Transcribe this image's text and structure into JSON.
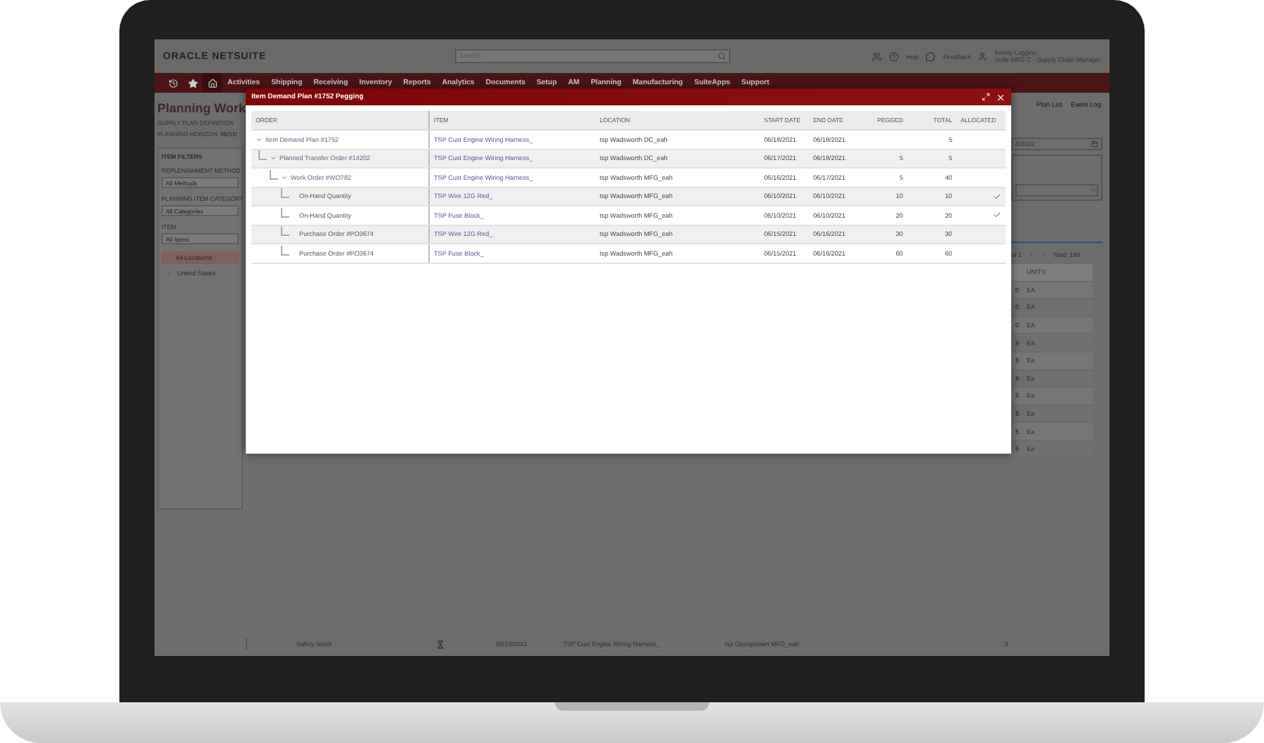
{
  "header": {
    "logo": "ORACLE NETSUITE",
    "search": {
      "placeholder": "Search"
    },
    "help": "Help",
    "feedback": "Feedback",
    "user": {
      "name": "Kenny Loggins",
      "role": "Suite MFG C - Supply Chain Manager"
    }
  },
  "nav": {
    "icons": [
      {
        "kind": "history",
        "selected": false
      },
      {
        "kind": "star",
        "selected": false
      },
      {
        "kind": "home",
        "selected": true
      }
    ],
    "items": [
      "Activities",
      "Shipping",
      "Receiving",
      "Inventory",
      "Reports",
      "Analytics",
      "Documents",
      "Setup",
      "AM",
      "Planning",
      "Manufacturing",
      "SuiteApps",
      "Support"
    ]
  },
  "page": {
    "title": "Planning Work",
    "supply_plan_definition": "SUPPLY PLAN DEFINITION",
    "planning_horizon_label": "PLANNING HORIZON",
    "planning_horizon_value": "06/11/"
  },
  "filters": {
    "title": "ITEM FILTERS",
    "fields": [
      {
        "label": "REPLENISHMENT METHOD",
        "placeholder": "All Methods"
      },
      {
        "label": "PLANNING ITEM CATEGORY",
        "placeholder": "All Categories"
      },
      {
        "label": "ITEM",
        "placeholder": "All Items"
      }
    ],
    "locations": [
      {
        "label": "All Locations",
        "selected": true
      },
      {
        "label": "United States",
        "selected": false,
        "expanded": false
      }
    ]
  },
  "links": [
    "Plan List",
    "Event Log"
  ],
  "date_field": {
    "value": "8/2022"
  },
  "pagination": {
    "page_of": "of 1",
    "total": "Total: 195"
  },
  "units_table": {
    "header": "UNITS",
    "rows": [
      {
        "column_1": "0",
        "units": "EA"
      },
      {
        "column_1": "0",
        "units": "EA"
      },
      {
        "column_1": "0",
        "units": "EA"
      },
      {
        "column_1": "8",
        "units": "EA"
      },
      {
        "column_1": "5",
        "units": "Ea"
      },
      {
        "column_1": "8",
        "units": "Ea"
      },
      {
        "column_1": "5",
        "units": "Ea"
      },
      {
        "column_1": "5",
        "units": "Ea"
      },
      {
        "column_1": "5",
        "units": "Ea"
      },
      {
        "column_1": "5",
        "units": "Ea"
      }
    ]
  },
  "background_row": {
    "type": "Safety Stock",
    "date": "06/10/2021",
    "item": "TSP Cust Engine Wiring Harness_",
    "location": "tsp Georgetown MFG_eah",
    "quantity": "5"
  },
  "dialog": {
    "title": "Item Demand Plan #1752 Pegging",
    "columns": [
      "ORDER",
      "ITEM",
      "LOCATION",
      "START DATE",
      "END DATE",
      "PEGGED",
      "TOTAL",
      "ALLOCATED"
    ],
    "rows": [
      {
        "order": "Item Demand Plan #1752",
        "item": "TSP Cust Engine Wiring Harness_",
        "location": "tsp Wadsworth DC_eah",
        "start_date": "06/18/2021",
        "end_date": "06/18/2021",
        "total": "5",
        "allocated": false,
        "expanded": true,
        "children": [
          {
            "order": "Planned Transfer Order #14202",
            "item": "TSP Cust Engine Wiring Harness_",
            "location": "tsp Wadsworth DC_eah",
            "start_date": "06/17/2021",
            "end_date": "06/18/2021",
            "pegged": "5",
            "total": "5",
            "allocated": false,
            "expanded": true,
            "children": [
              {
                "order": "Work Order #WO782",
                "item": "TSP Cust Engine Wiring Harness_",
                "location": "tsp Wadsworth MFG_eah",
                "start_date": "06/16/2021",
                "end_date": "06/17/2021",
                "pegged": "5",
                "total": "40",
                "allocated": false,
                "expanded": true,
                "children": [
                  {
                    "order": "On-Hand Quantity",
                    "item": "TSP Wire 12G Red_",
                    "location": "tsp Wadsworth MFG_eah",
                    "start_date": "06/10/2021",
                    "end_date": "06/10/2021",
                    "pegged": "10",
                    "total": "10",
                    "allocated": true
                  },
                  {
                    "order": "On-Hand Quantity",
                    "item": "TSP Fuse Block_",
                    "location": "tsp Wadsworth MFG_eah",
                    "start_date": "06/10/2021",
                    "end_date": "06/10/2021",
                    "pegged": "20",
                    "total": "20",
                    "allocated": true
                  },
                  {
                    "order": "Purchase Order #PO3674",
                    "item": "TSP Wire 12G Red_",
                    "location": "tsp Wadsworth MFG_eah",
                    "start_date": "06/15/2021",
                    "end_date": "06/16/2021",
                    "pegged": "30",
                    "total": "30",
                    "allocated": false
                  },
                  {
                    "order": "Purchase Order #PO3674",
                    "item": "TSP Fuse Block_",
                    "location": "tsp Wadsworth MFG_eah",
                    "start_date": "06/15/2021",
                    "end_date": "06/16/2021",
                    "pegged": "60",
                    "total": "60",
                    "allocated": false
                  }
                ]
              }
            ]
          }
        ]
      }
    ]
  }
}
